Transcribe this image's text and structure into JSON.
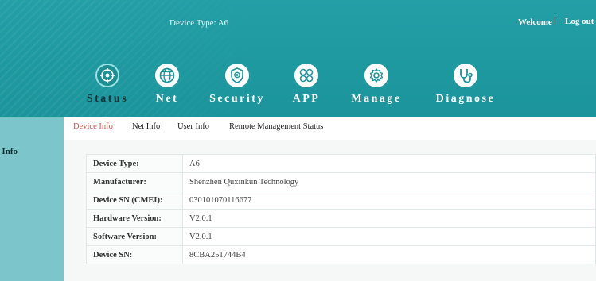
{
  "header": {
    "device_type": "Device Type: A6",
    "welcome": "Welcome",
    "logout": "Log out"
  },
  "nav": [
    {
      "label": "Status",
      "icon": "status-icon",
      "active": true
    },
    {
      "label": "Net",
      "icon": "globe-icon",
      "active": false
    },
    {
      "label": "Security",
      "icon": "shield-icon",
      "active": false
    },
    {
      "label": "APP",
      "icon": "apps-icon",
      "active": false
    },
    {
      "label": "Manage",
      "icon": "gear-icon",
      "active": false
    },
    {
      "label": "Diagnose",
      "icon": "stethoscope-icon",
      "active": false
    }
  ],
  "subtabs": [
    {
      "label": "Device Info",
      "active": true
    },
    {
      "label": "Net Info",
      "active": false
    },
    {
      "label": "User Info",
      "active": false
    },
    {
      "label": "Remote Management Status",
      "active": false
    }
  ],
  "sidebar": {
    "items": [
      {
        "label": "Device Info"
      }
    ]
  },
  "device_info": [
    {
      "key": "Device Type:",
      "value": "A6"
    },
    {
      "key": "Manufacturer:",
      "value": "Shenzhen Quxinkun Technology"
    },
    {
      "key": "Device SN (CMEI):",
      "value": "030101070116677"
    },
    {
      "key": "Hardware Version:",
      "value": "V2.0.1"
    },
    {
      "key": "Software Version:",
      "value": "V2.0.1"
    },
    {
      "key": "Device SN:",
      "value": "8CBA251744B4"
    }
  ],
  "colors": {
    "header": "#1b949b",
    "sidebar": "#7cc6cb",
    "active_tab": "#d9534f"
  }
}
